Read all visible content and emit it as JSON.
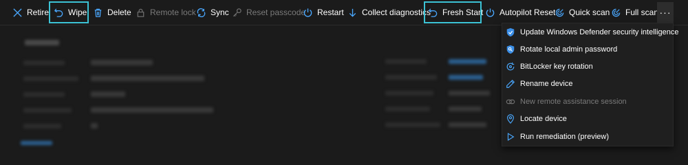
{
  "toolbar": {
    "retire": "Retire",
    "wipe": "Wipe",
    "delete": "Delete",
    "remote_lock": "Remote lock",
    "sync": "Sync",
    "reset_passcode": "Reset passcode",
    "restart": "Restart",
    "collect_diagnostics": "Collect diagnostics",
    "fresh_start": "Fresh Start",
    "autopilot_reset": "Autopilot Reset",
    "quick_scan": "Quick scan",
    "full_scan": "Full scan",
    "more": "···"
  },
  "menu": {
    "update_defender": "Update Windows Defender security intelligence",
    "rotate_admin_password": "Rotate local admin password",
    "bitlocker_rotation": "BitLocker key rotation",
    "rename_device": "Rename device",
    "remote_assistance": "New remote assistance session",
    "locate_device": "Locate device",
    "run_remediation": "Run remediation (preview)"
  },
  "colors": {
    "background": "#1b1b1b",
    "accent_icon": "#4aa8ff",
    "highlight_border": "#3cc3d5",
    "disabled_text": "#7a7a7a"
  }
}
